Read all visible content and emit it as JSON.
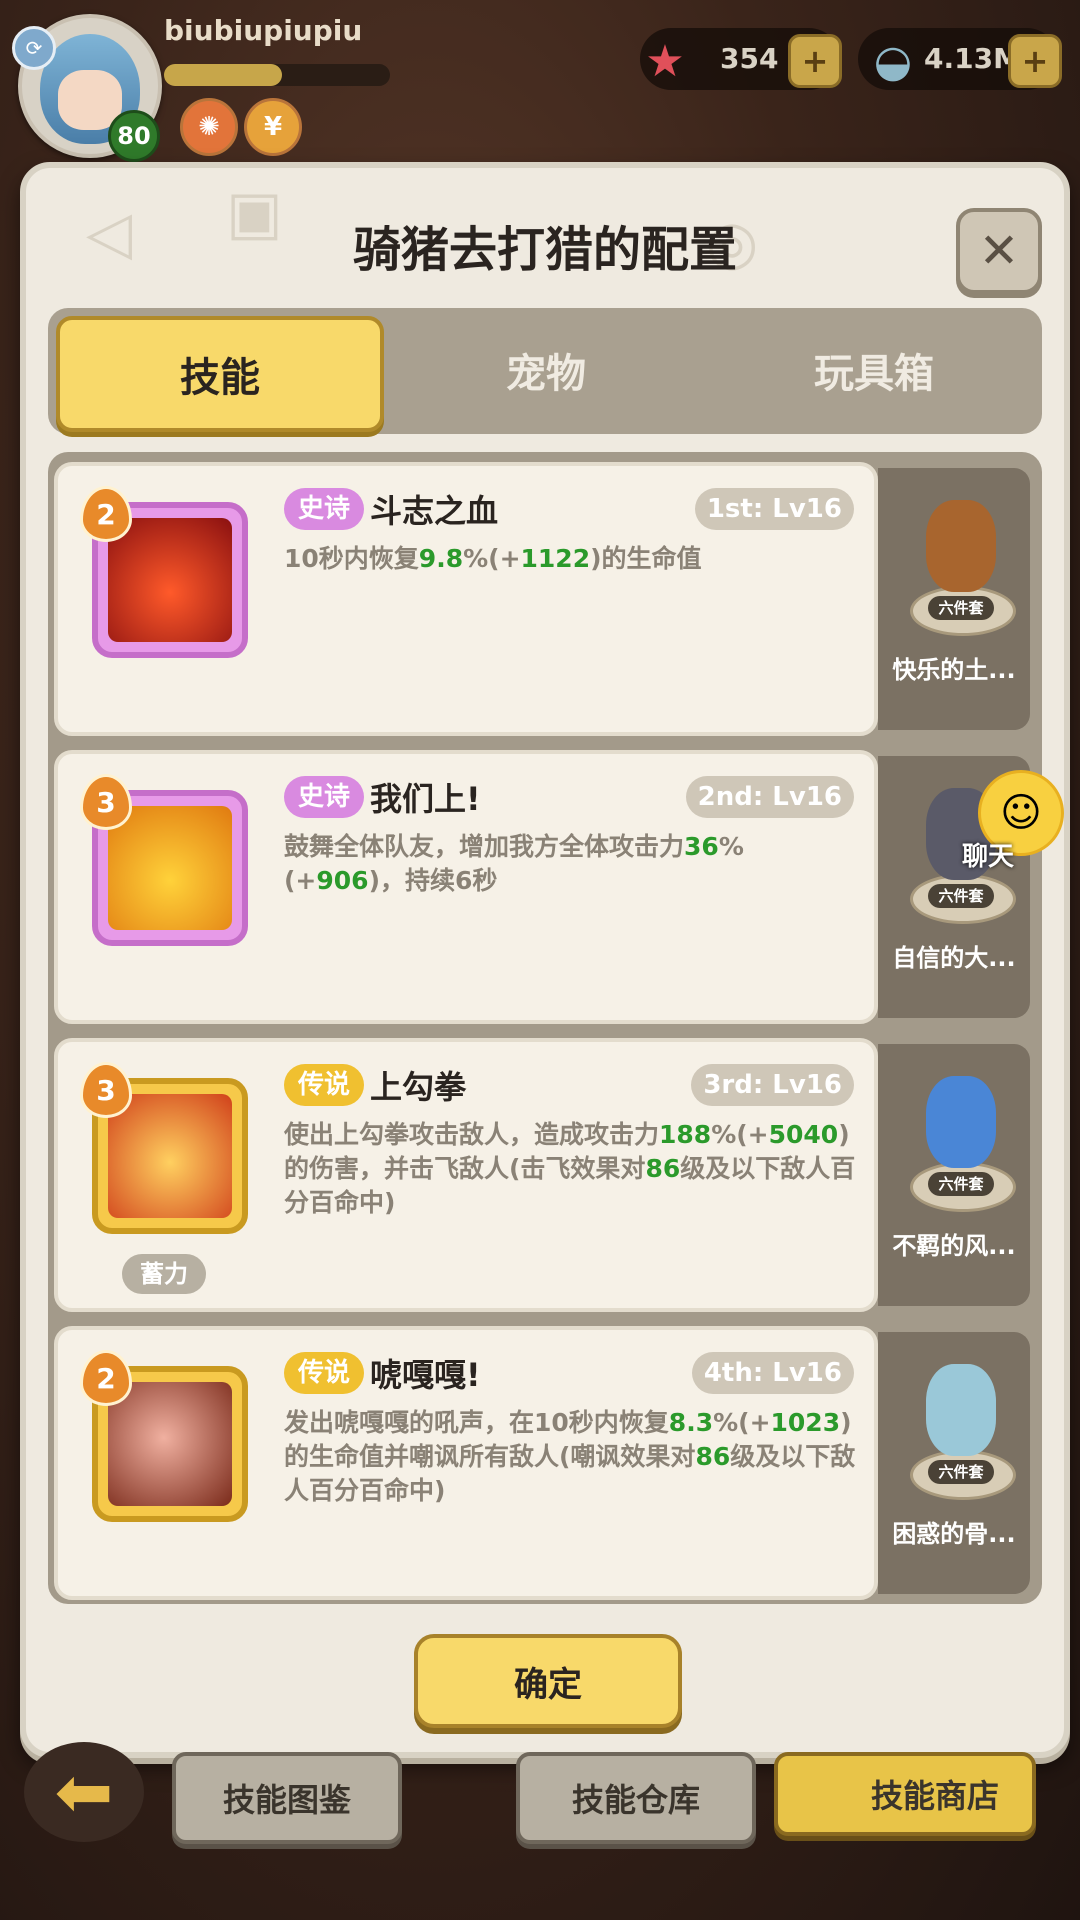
{
  "player": {
    "username": "biubiupiupiu",
    "level": "80",
    "xp_fraction": 0.52
  },
  "currencies": [
    {
      "icon": "starfish-icon",
      "value": "354"
    },
    {
      "icon": "shell-icon",
      "value": "4.13M"
    }
  ],
  "modal": {
    "title": "骑猪去打猎的配置",
    "tabs": [
      {
        "label": "技能",
        "active": true
      },
      {
        "label": "宠物",
        "active": false
      },
      {
        "label": "玩具箱",
        "active": false
      }
    ],
    "confirm_label": "确定"
  },
  "skills": [
    {
      "badge": "2",
      "rarity": "史诗",
      "name": "斗志之血",
      "slot": "1st: Lv16",
      "desc_parts": [
        "10秒内恢复",
        "9.8",
        "%(+",
        "1122",
        ")的生命值"
      ],
      "tag": "",
      "pet": {
        "set": "六件套",
        "name": "快乐的土..."
      }
    },
    {
      "badge": "3",
      "rarity": "史诗",
      "name": "我们上!",
      "slot": "2nd: Lv16",
      "desc_parts": [
        "鼓舞全体队友，增加我方全体攻击力",
        "36",
        "%(+",
        "906",
        ")，持续6秒"
      ],
      "tag": "",
      "pet": {
        "set": "六件套",
        "name": "自信的大..."
      }
    },
    {
      "badge": "3",
      "rarity": "传说",
      "name": "上勾拳",
      "slot": "3rd: Lv16",
      "desc_parts": [
        "使出上勾拳攻击敌人，造成攻击力",
        "188",
        "%(+",
        "5040",
        ")的伤害，并击飞敌人(击飞效果对",
        "86",
        "级及以下敌人百分百命中)"
      ],
      "tag": "蓄力",
      "pet": {
        "set": "六件套",
        "name": "不羁的风..."
      }
    },
    {
      "badge": "2",
      "rarity": "传说",
      "name": "唬嘎嘎!",
      "slot": "4th: Lv16",
      "desc_parts": [
        "发出唬嘎嘎的吼声，在10秒内恢复",
        "8.3",
        "%(+",
        "1023",
        ")的生命值并嘲讽所有敌人(嘲讽效果对",
        "86",
        "级及以下敌人百分百命中)"
      ],
      "tag": "",
      "pet": {
        "set": "六件套",
        "name": "困惑的骨..."
      }
    }
  ],
  "chat": {
    "label": "聊天"
  },
  "bottom_buttons": [
    {
      "label": "技能图鉴"
    },
    {
      "label": "技能仓库"
    },
    {
      "label": "技能商店"
    }
  ],
  "colors": {
    "accent_yellow": "#f8d96a",
    "epic_purple": "#d98ae0",
    "legend_gold": "#f0c030",
    "value_green": "#2b9a2b"
  }
}
